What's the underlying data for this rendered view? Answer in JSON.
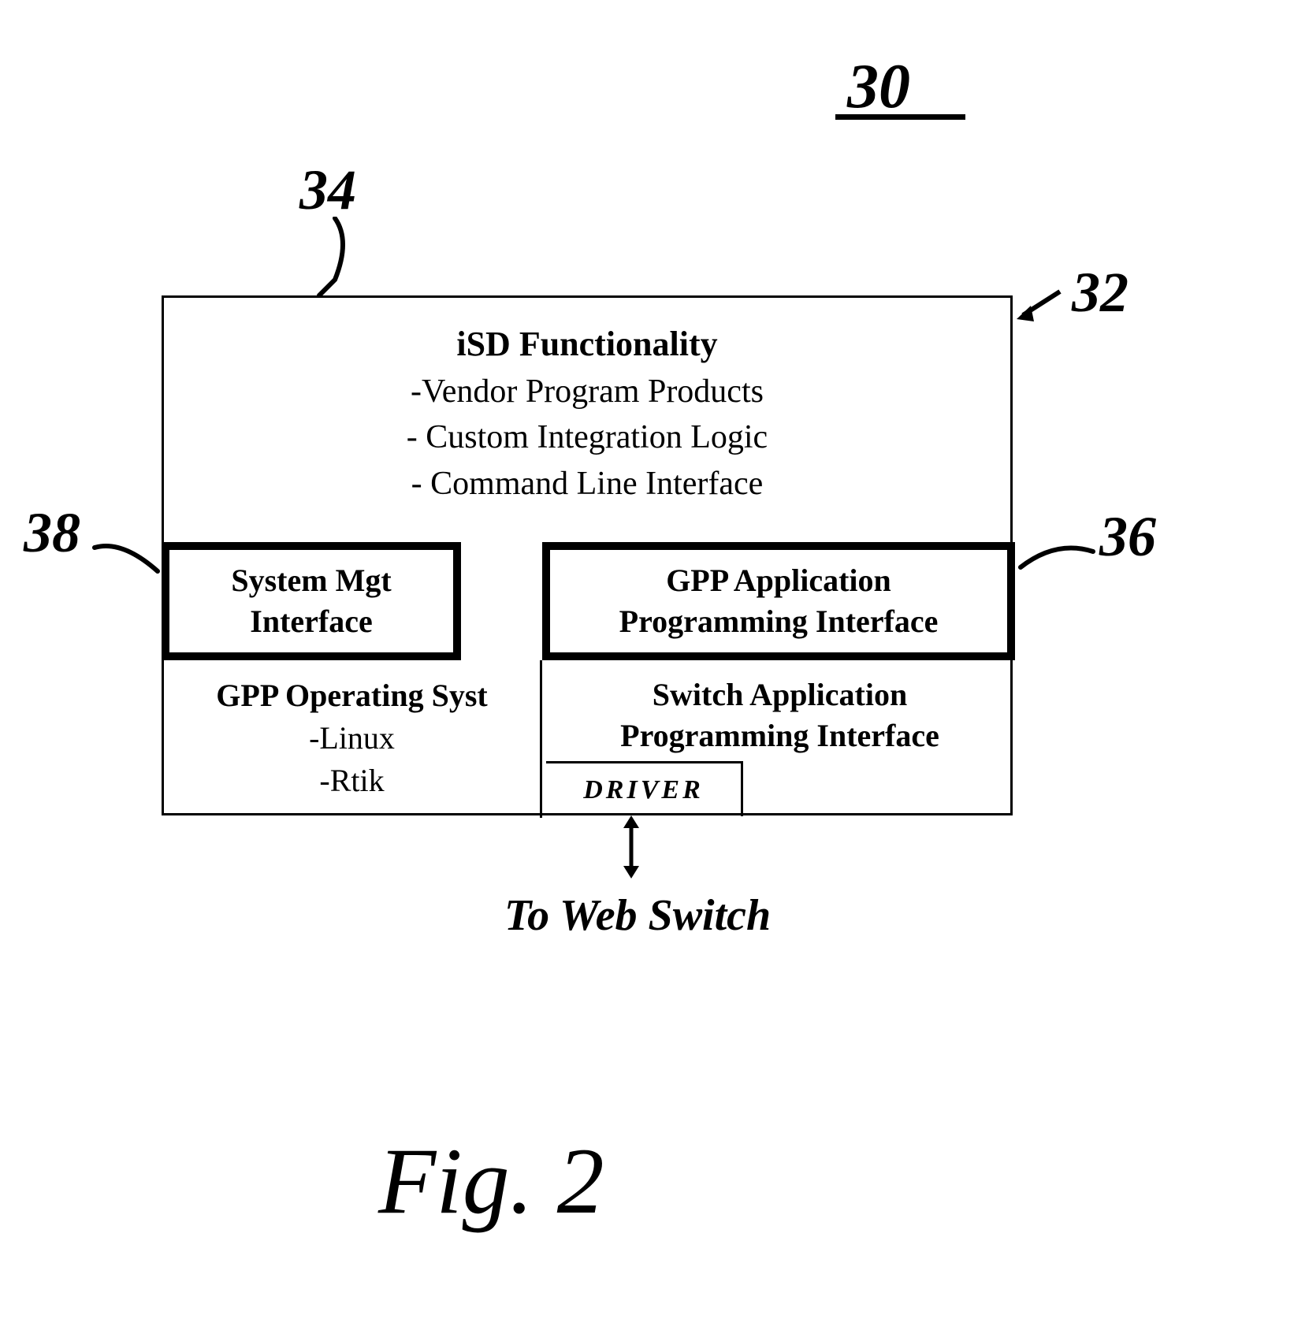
{
  "labels": {
    "n30": "30",
    "n34": "34",
    "n32": "32",
    "n38": "38",
    "n36": "36",
    "fig": "Fig. 2",
    "toWebSwitch": "To Web Switch"
  },
  "top": {
    "title": "iSD Functionality",
    "line1": "-Vendor Program Products",
    "line2": "- Custom Integration Logic",
    "line3": "- Command Line Interface"
  },
  "sysMgt": {
    "line1": "System Mgt",
    "line2": "Interface"
  },
  "gppApi": {
    "line1": "GPP Application",
    "line2": "Programming Interface"
  },
  "gppOs": {
    "head": "GPP Operating Syst",
    "line1": "-Linux",
    "line2": "-Rtik"
  },
  "switchApi": {
    "line1": "Switch Application",
    "line2": "Programming Interface"
  },
  "driver": "DRIVER"
}
